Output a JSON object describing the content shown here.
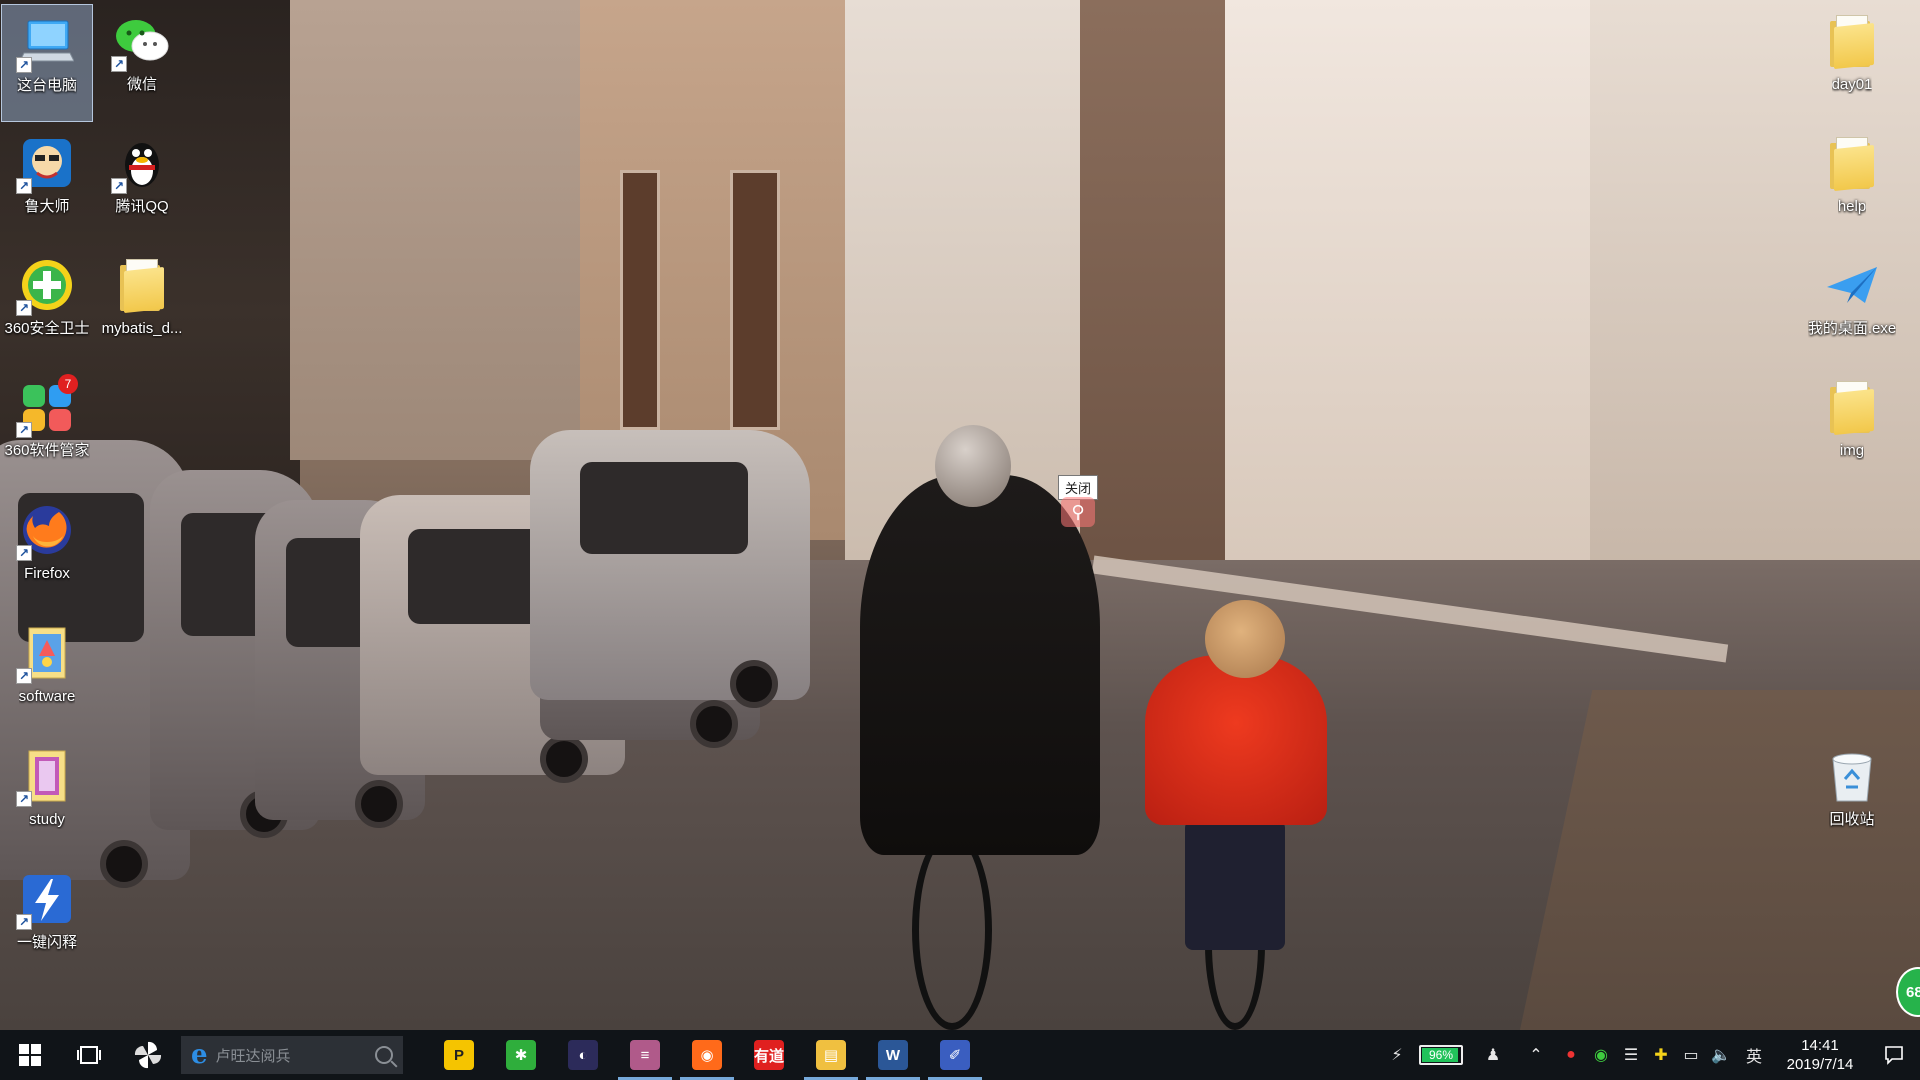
{
  "desktop": {
    "left_icons": [
      {
        "id": "this-pc",
        "label": "这台电脑",
        "icon": "computer-icon",
        "selected": true
      },
      {
        "id": "wechat",
        "label": "微信",
        "icon": "wechat-icon"
      },
      {
        "id": "ludashi",
        "label": "鲁大师",
        "icon": "ludashi-icon"
      },
      {
        "id": "qq",
        "label": "腾讯QQ",
        "icon": "qq-penguin-icon"
      },
      {
        "id": "360-security",
        "label": "360安全卫士",
        "icon": "360-shield-icon"
      },
      {
        "id": "mybatis",
        "label": "mybatis_d...",
        "icon": "folder-icon"
      },
      {
        "id": "360-soft",
        "label": "360软件管家",
        "icon": "360-softmgr-icon",
        "badge": "7"
      },
      {
        "id": "firefox",
        "label": "Firefox",
        "icon": "firefox-icon"
      },
      {
        "id": "software",
        "label": "software",
        "icon": "folder-icon"
      },
      {
        "id": "study",
        "label": "study",
        "icon": "folder-icon"
      },
      {
        "id": "flash",
        "label": "一键闪释",
        "icon": "lightning-icon"
      }
    ],
    "right_icons": [
      {
        "id": "day01",
        "label": "day01",
        "icon": "folder-icon"
      },
      {
        "id": "help",
        "label": "help",
        "icon": "folder-icon"
      },
      {
        "id": "my-desktop",
        "label": "我的桌面.exe",
        "icon": "paper-plane-icon"
      },
      {
        "id": "img",
        "label": "img",
        "icon": "folder-icon"
      },
      {
        "id": "recycle",
        "label": "回收站",
        "icon": "recycle-bin-icon"
      }
    ],
    "close_popup": "关闭",
    "float_badge": "68"
  },
  "taskbar": {
    "search_placeholder": "卢旺达阅兵",
    "pinned": [
      {
        "id": "kmplayer",
        "icon": "kmplayer-icon",
        "text": "P",
        "color": "#f5c400",
        "running": false
      },
      {
        "id": "green-app",
        "icon": "leaf-icon",
        "text": "✱",
        "color": "#2fae3c",
        "running": false
      },
      {
        "id": "eclipse",
        "icon": "eclipse-icon",
        "text": "◐",
        "color": "#2c2b5a",
        "running": false
      },
      {
        "id": "db-tool",
        "icon": "database-icon",
        "text": "≡",
        "color": "#b05a8a",
        "running": true
      },
      {
        "id": "firefox",
        "icon": "firefox-icon",
        "text": "◉",
        "color": "#ff6a1a",
        "running": true
      },
      {
        "id": "youdao",
        "icon": "youdao-icon",
        "text": "有道",
        "color": "#e0201f",
        "running": false
      },
      {
        "id": "explorer",
        "icon": "folder-icon",
        "text": "▤",
        "color": "#f0c040",
        "running": true
      },
      {
        "id": "word",
        "icon": "word-icon",
        "text": "W",
        "color": "#2b5797",
        "running": true
      },
      {
        "id": "typora",
        "icon": "pen-icon",
        "text": "✐",
        "color": "#3a5ec0",
        "running": true
      }
    ],
    "battery_percent": "96%",
    "battery_level": 0.96,
    "ime": "英",
    "time": "14:41",
    "date": "2019/7/14"
  }
}
